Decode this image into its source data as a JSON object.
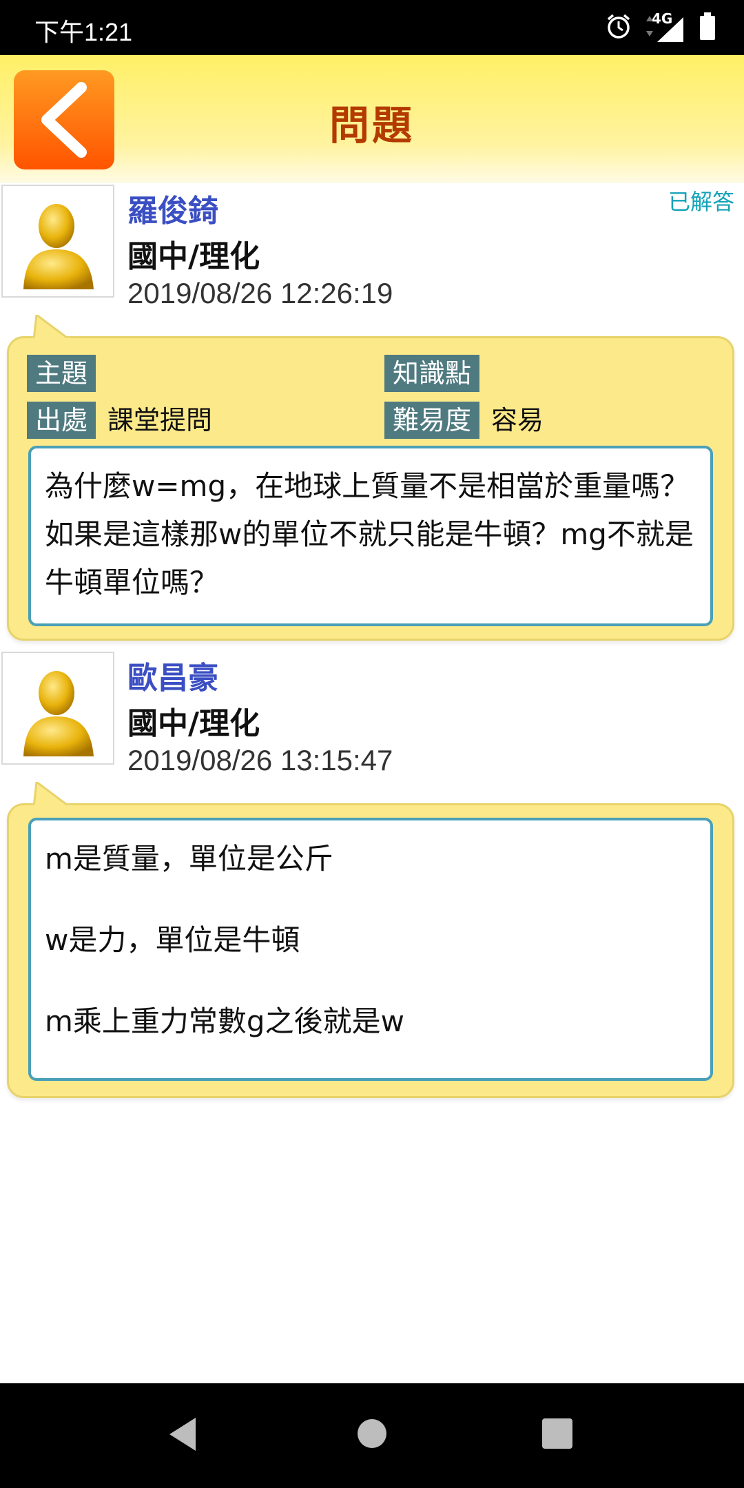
{
  "status_bar": {
    "time": "下午1:21",
    "network": "4G"
  },
  "header": {
    "title": "問題"
  },
  "question": {
    "user": "羅俊錡",
    "subject": "國中/理化",
    "datetime": "2019/08/26 12:26:19",
    "status": "已解答",
    "tags": {
      "topic_label": "主題",
      "topic_value": "",
      "knowledge_label": "知識點",
      "knowledge_value": "",
      "source_label": "出處",
      "source_value": "課堂提問",
      "difficulty_label": "難易度",
      "difficulty_value": "容易"
    },
    "text": "為什麼w=mg，在地球上質量不是相當於重量嗎？如果是這樣那w的單位不就只能是牛頓？mg不就是牛頓單位嗎？"
  },
  "answer": {
    "user": "歐昌豪",
    "subject": "國中/理化",
    "datetime": "2019/08/26 13:15:47",
    "lines": [
      "m是質量，單位是公斤",
      "w是力，單位是牛頓",
      "m乘上重力常數g之後就是w"
    ]
  },
  "colors": {
    "header_bg": "#fff066",
    "accent_title": "#b33a00",
    "name": "#3b4fc3",
    "status": "#14a3b8",
    "bubble": "#fce98a"
  }
}
